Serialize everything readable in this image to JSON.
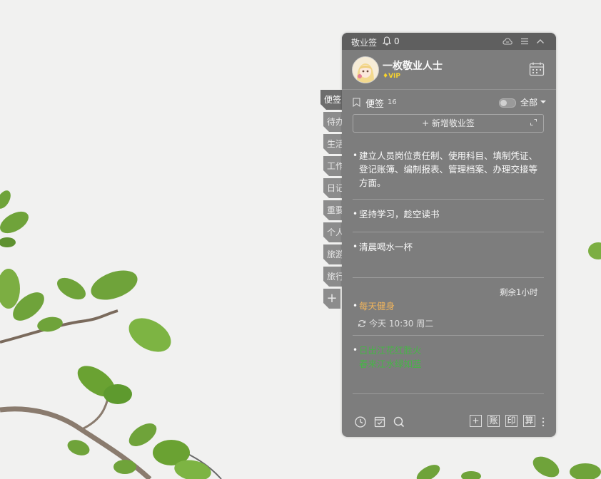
{
  "app": {
    "title": "敬业签",
    "notification_count": "0",
    "user": {
      "name": "一枚敬业人士",
      "badge": "VIP"
    }
  },
  "side_tabs": [
    {
      "label": "便签",
      "active": true
    },
    {
      "label": "待办"
    },
    {
      "label": "生活"
    },
    {
      "label": "工作"
    },
    {
      "label": "日记"
    },
    {
      "label": "重要"
    },
    {
      "label": "个人"
    },
    {
      "label": "旅游"
    },
    {
      "label": "旅行"
    },
    {
      "label": "+"
    }
  ],
  "notes_header": {
    "title": "便签",
    "count": "16",
    "filter": "全部"
  },
  "new_note_label": "+ 新增敬业签",
  "notes": [
    {
      "text": "建立人员岗位责任制、使用科目、填制凭证、登记账簿、编制报表、管理档案、办理交接等方面。"
    },
    {
      "text": "坚持学习，趁空读书"
    },
    {
      "text": "清晨喝水一杯"
    },
    {
      "text": "每天健身",
      "remaining": "剩余1小时",
      "reminder": "今天 10:30 周二",
      "color": "#f0b45c"
    },
    {
      "text": "日出江花红胜火\n春来江水绿如蓝",
      "color": "#47b547"
    }
  ],
  "footer": {
    "icons": [
      "clock-icon",
      "archive-icon",
      "search-icon"
    ],
    "buttons": [
      "+",
      "账",
      "印",
      "算"
    ]
  },
  "colors": {
    "panel": "#7d7d7d",
    "titlebar": "#5f5f5f",
    "orange_note": "#f0b45c",
    "green_note": "#47b547",
    "vip": "#f7d32d"
  }
}
